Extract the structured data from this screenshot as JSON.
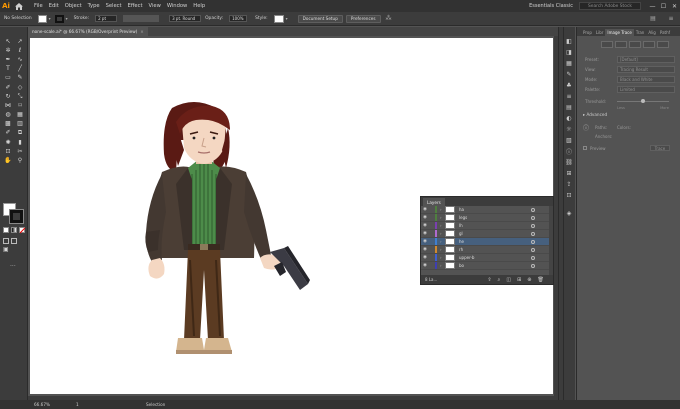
{
  "app": {
    "logo": "Ai"
  },
  "menu": [
    "File",
    "Edit",
    "Object",
    "Type",
    "Select",
    "Effect",
    "View",
    "Window",
    "Help"
  ],
  "workspace": "Essentials Classic",
  "search_placeholder": "Search Adobe Stock",
  "window_controls": [
    "—",
    "☐",
    "✕"
  ],
  "control": {
    "selection_label": "No Selection",
    "stroke_label": "Stroke:",
    "stroke_value": "2 pt",
    "brush_value": "3 pt. Round",
    "opacity_label": "Opacity:",
    "opacity_value": "100%",
    "style_label": "Style:",
    "doc_setup": "Document Setup",
    "preferences": "Preferences"
  },
  "doc_tab": {
    "title": "none-scale.ai* @ 66.67% (RGB/Overprint Preview)",
    "close": "×"
  },
  "status": {
    "zoom": "66.67%",
    "page": "1",
    "mode": "Selection"
  },
  "props_tabs": [
    "Prop",
    "Libr",
    "Image Trace",
    "Tran",
    "Alig",
    "Pathf"
  ],
  "image_trace": {
    "rows": [
      {
        "label": "Preset:",
        "value": "[Default]"
      },
      {
        "label": "View:",
        "value": "Tracing Result"
      },
      {
        "label": "Mode:",
        "value": "Black and White"
      },
      {
        "label": "Palette:",
        "value": "Limited"
      }
    ],
    "threshold_label": "Threshold:",
    "tick_left": "Less",
    "tick_right": "More",
    "advanced": "Advanced",
    "paths_label": "Paths:",
    "colors_label": "Colors:",
    "anchors_label": "Anchors:",
    "preview_label": "Preview",
    "trace_label": "Trace"
  },
  "layers": {
    "tab": "Layers",
    "items": [
      {
        "name": "ha",
        "color": "#4f7f3f",
        "selected": false
      },
      {
        "name": "legs",
        "color": "#4f7f3f",
        "selected": false
      },
      {
        "name": "lh",
        "color": "#7a3fb0",
        "selected": false
      },
      {
        "name": "gl",
        "color": "#b06bd0",
        "selected": false
      },
      {
        "name": "he",
        "color": "#3f7fd0",
        "selected": true
      },
      {
        "name": "rh",
        "color": "#d08a2f",
        "selected": false
      },
      {
        "name": "upper-b",
        "color": "#3f5fd0",
        "selected": false
      },
      {
        "name": "bo",
        "color": "#3f3fb0",
        "selected": false
      }
    ],
    "footer": "8 La..."
  }
}
